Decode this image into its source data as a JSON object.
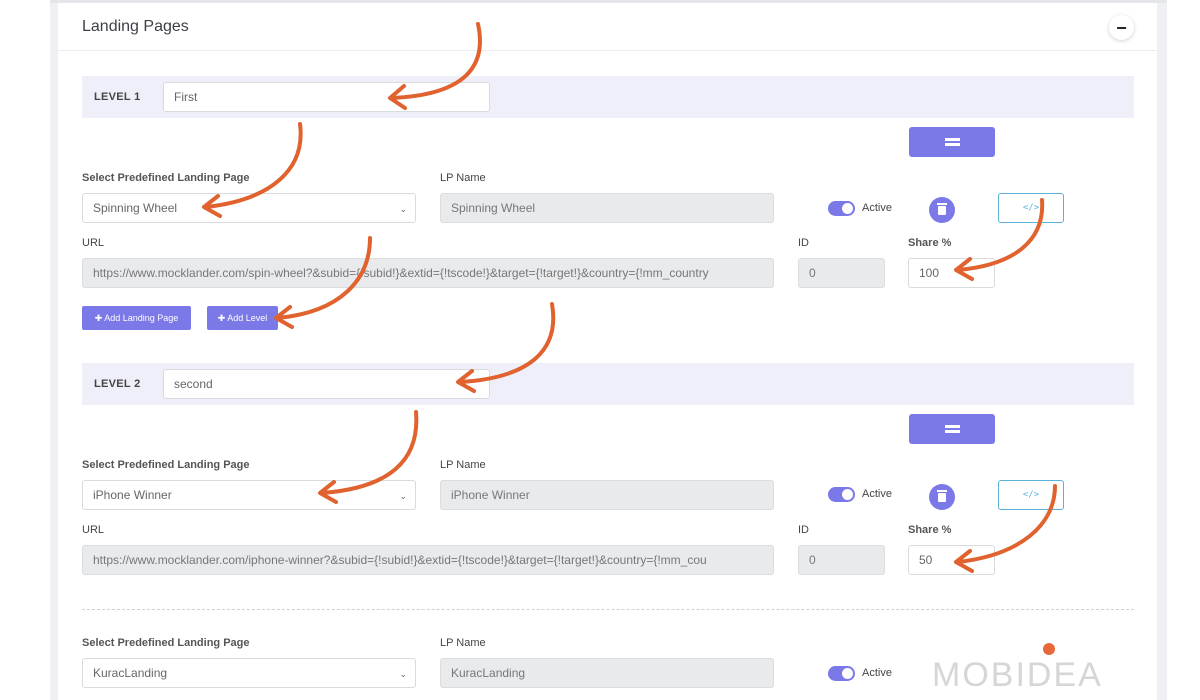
{
  "card": {
    "title": "Landing Pages",
    "collapse_symbol": "−"
  },
  "levels": [
    {
      "label": "LEVEL 1",
      "name_value": "First",
      "select_label": "Select Predefined Landing Page",
      "select_value": "Spinning Wheel",
      "lp_name_label": "LP Name",
      "lp_name_value": "Spinning Wheel",
      "active_label": "Active",
      "url_label": "URL",
      "url_value": "https://www.mocklander.com/spin-wheel?&subid={!subid!}&extid={!tscode!}&target={!target!}&country={!mm_country",
      "id_label": "ID",
      "id_value": "0",
      "share_label": "Share %",
      "share_value": "100",
      "add_landing_label": "✚ Add Landing Page",
      "add_level_label": "✚ Add Level"
    },
    {
      "label": "LEVEL 2",
      "name_value": "second",
      "select_label": "Select Predefined Landing Page",
      "select_value": "iPhone Winner",
      "lp_name_label": "LP Name",
      "lp_name_value": "iPhone Winner",
      "active_label": "Active",
      "url_label": "URL",
      "url_value": "https://www.mocklander.com/iphone-winner?&subid={!subid!}&extid={!tscode!}&target={!target!}&country={!mm_cou",
      "id_label": "ID",
      "id_value": "0",
      "share_label": "Share %",
      "share_value": "50"
    }
  ],
  "third": {
    "select_label": "Select Predefined Landing Page",
    "select_value": "KuracLanding",
    "lp_name_label": "LP Name",
    "lp_name_value": "KuracLanding",
    "active_label": "Active"
  },
  "code_button_glyph": "</>",
  "watermark": "MOBIDEA",
  "colors": {
    "accent": "#7b78e8",
    "arrow": "#e0622f",
    "code_border": "#5bb2d8",
    "level_bg": "#efeff9"
  }
}
